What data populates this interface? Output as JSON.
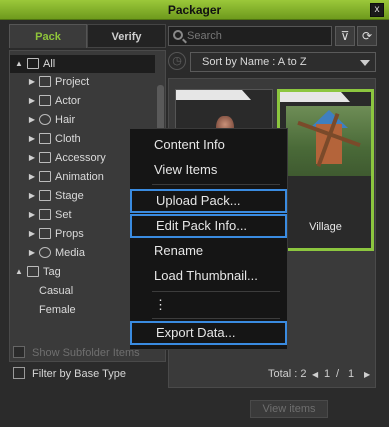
{
  "window": {
    "title": "Packager",
    "close_glyph": "x"
  },
  "left_panel": {
    "tabs": [
      {
        "label": "Pack"
      },
      {
        "label": "Verify"
      }
    ],
    "tree": [
      {
        "label": "All",
        "icon": "pages-icon",
        "arrow": "▲",
        "selected": true
      },
      {
        "label": "Project",
        "icon": "folder-icon",
        "arrow": "▶"
      },
      {
        "label": "Actor",
        "icon": "person-icon",
        "arrow": "▶"
      },
      {
        "label": "Hair",
        "icon": "hair-icon",
        "arrow": "▶"
      },
      {
        "label": "Cloth",
        "icon": "cloth-icon",
        "arrow": "▶"
      },
      {
        "label": "Accessory",
        "icon": "accessory-icon",
        "arrow": "▶"
      },
      {
        "label": "Animation",
        "icon": "animation-icon",
        "arrow": "▶"
      },
      {
        "label": "Stage",
        "icon": "stage-icon",
        "arrow": "▶"
      },
      {
        "label": "Set",
        "icon": "set-icon",
        "arrow": "▶"
      },
      {
        "label": "Props",
        "icon": "props-icon",
        "arrow": "▶"
      },
      {
        "label": "Media",
        "icon": "media-icon",
        "arrow": "▶"
      },
      {
        "label": "Tag",
        "icon": "tag-icon",
        "arrow": "▲"
      },
      {
        "label": "Casual"
      },
      {
        "label": "Female"
      }
    ],
    "show_subfolder_items": "Show Subfolder Items",
    "filter_by_base_type": "Filter by Base Type"
  },
  "right_panel": {
    "search_placeholder": "Search",
    "sort_label": "Sort by Name : A to Z",
    "items": [
      {
        "name": "Village",
        "selected": true
      }
    ],
    "footer": {
      "total": "Total : 2",
      "page_current": "1",
      "page_sep": "/",
      "page_total": "1"
    },
    "view_items_button": "View items"
  },
  "context_menu": {
    "items": [
      {
        "label": "Content Info",
        "highlight": false
      },
      {
        "label": "View Items",
        "highlight": false
      },
      {
        "label": "Upload Pack...",
        "highlight": true
      },
      {
        "label": "Edit Pack Info...",
        "highlight": true
      },
      {
        "label": "Rename",
        "highlight": false
      },
      {
        "label": "Load Thumbnail...",
        "highlight": false
      },
      {
        "label": "⋮",
        "highlight": false
      },
      {
        "label": "Export Data...",
        "highlight": true
      }
    ]
  },
  "colors": {
    "accent": "#8cc63f",
    "highlight_border": "#3a8be0",
    "title_bar": "#8ab62e"
  }
}
